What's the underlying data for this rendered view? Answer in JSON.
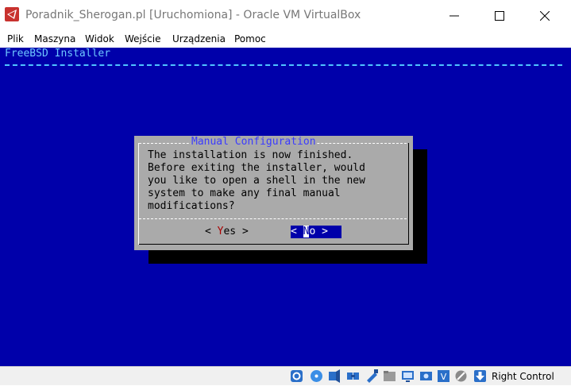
{
  "window": {
    "title": "Poradnik_Sherogan.pl [Uruchomiona] - Oracle VM VirtualBox"
  },
  "menu": [
    "Plik",
    "Maszyna",
    "Widok",
    "Wejście",
    "Urządzenia",
    "Pomoc"
  ],
  "screen": {
    "installer_title": "FreeBSD Installer",
    "dialog": {
      "title": "Manual Configuration",
      "body": "The installation is now finished.\nBefore exiting the installer, would\nyou like to open a shell in the new\nsystem to make any final manual\nmodifications?",
      "yes": {
        "lead": "< ",
        "hotkey": "Y",
        "rest": "es >"
      },
      "no": {
        "lead": "< ",
        "cursor": "N",
        "rest": "o >"
      }
    }
  },
  "statusbar": {
    "host_key": "Right Control",
    "icons": [
      "optical-drive-icon",
      "cd-icon",
      "audio-icon",
      "network-icon",
      "usb-icon",
      "shared-folder-icon",
      "display-icon",
      "screen-capture-icon",
      "vm-settings-icon",
      "mouse-integration-icon",
      "host-key-arrow-icon"
    ]
  },
  "colors": {
    "screen_bg": "#0000aa",
    "dialog_bg": "#aaaaaa",
    "dialog_title": "#3b3bff",
    "yes_hotkey": "#aa0000",
    "installer_title": "#6ec8ff"
  }
}
